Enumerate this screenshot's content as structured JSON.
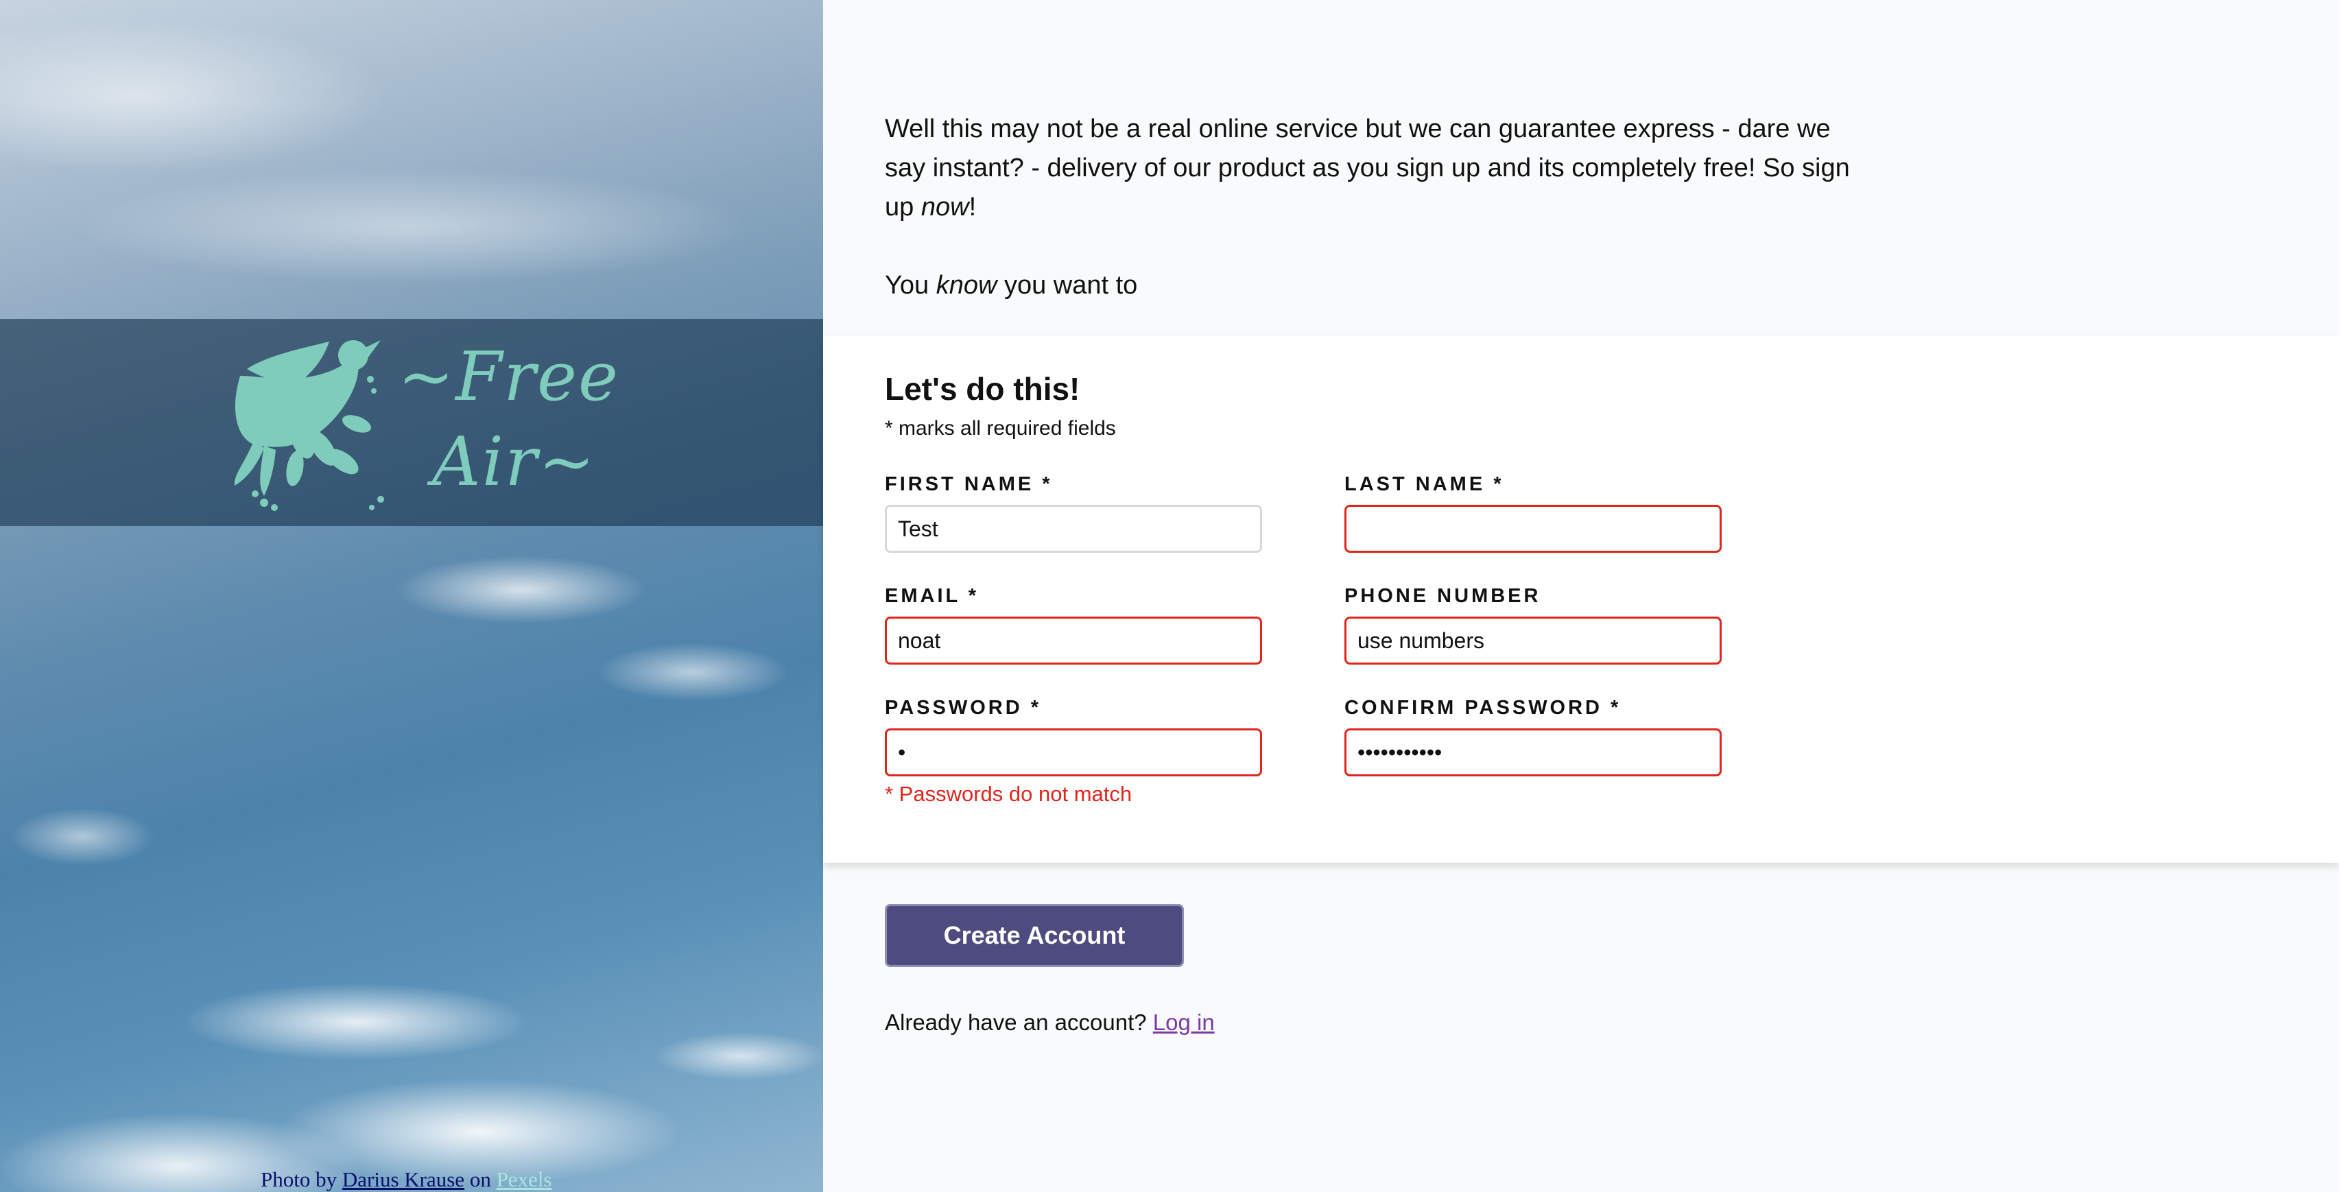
{
  "hero": {
    "logo_line1": "~Free",
    "logo_line2": "Air~",
    "credit": {
      "prefix": "Photo by",
      "author": "Darius Krause",
      "mid": "on",
      "site": "Pexels"
    }
  },
  "intro": {
    "p1_before": "Well this may not be a real online service but we can guarantee express - dare we say instant? - delivery of our product as you sign up and its completely free! So sign up",
    "p1_emph": "now",
    "p1_after": "!",
    "p2_before": "You",
    "p2_emph": "know",
    "p2_after": "you want to"
  },
  "form": {
    "title": "Let's do this!",
    "note": "* marks all required fields",
    "fields": {
      "first_name": {
        "label": "First Name *",
        "value": "Test",
        "invalid": false
      },
      "last_name": {
        "label": "Last Name *",
        "value": "",
        "invalid": true
      },
      "email": {
        "label": "Email *",
        "value": "noat",
        "invalid": true
      },
      "phone": {
        "label": "Phone Number",
        "value": "use numbers",
        "invalid": true
      },
      "password": {
        "label": "Password *",
        "value": "•",
        "invalid": true,
        "error": "* Passwords do not match"
      },
      "confirm_password": {
        "label": "Confirm Password *",
        "value": "•••••••••••",
        "invalid": true
      }
    }
  },
  "actions": {
    "create_label": "Create Account",
    "login_prompt": "Already have an account?",
    "login_link": "Log in"
  },
  "colors": {
    "accent": "#4e4c7f",
    "error": "#e0251b",
    "logo": "#7fcbbc",
    "link_visited": "#7b3aa6"
  }
}
